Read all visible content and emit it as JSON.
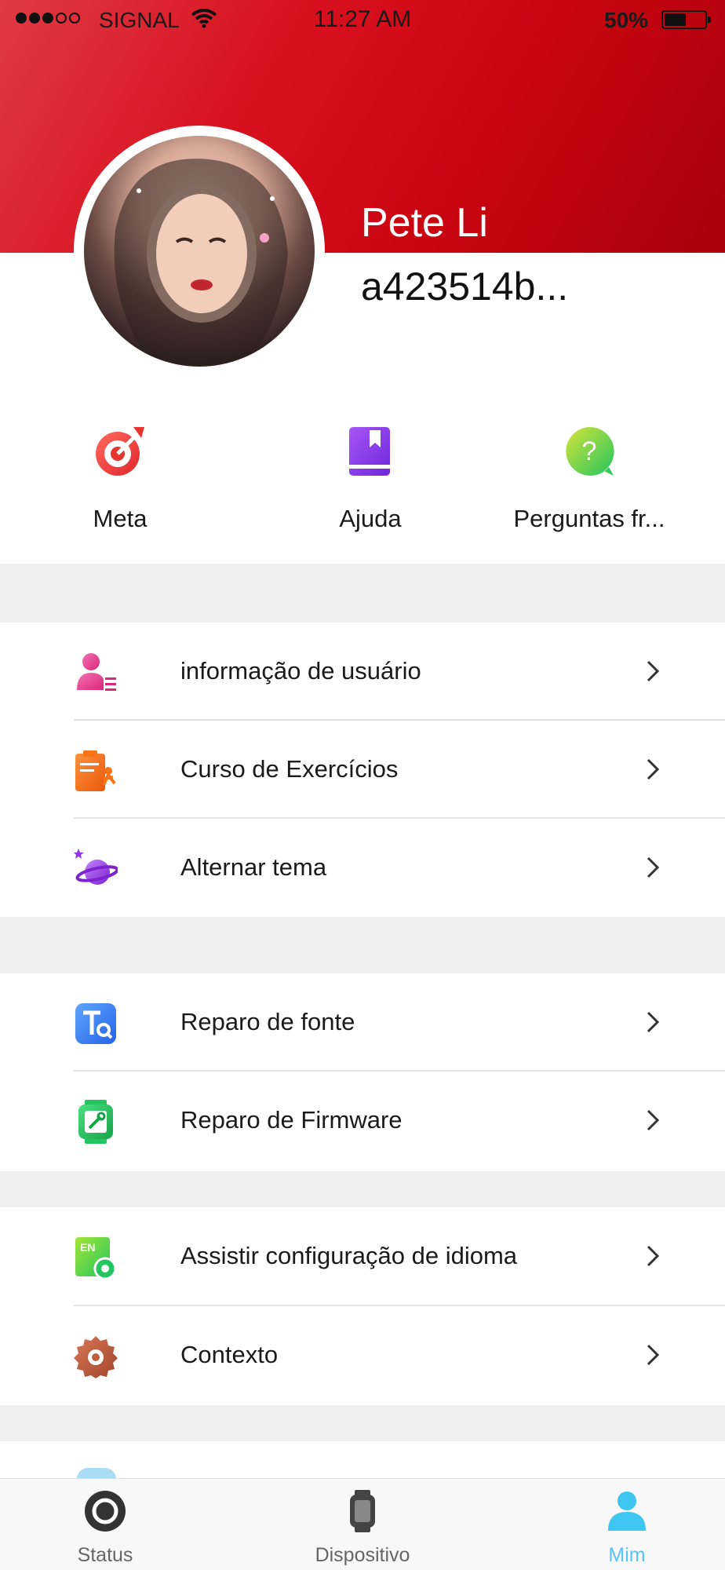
{
  "status_bar": {
    "carrier": "SIGNAL",
    "time": "11:27 AM",
    "battery": "50%"
  },
  "profile": {
    "name": "Pete Li",
    "id": "a423514b..."
  },
  "quick_actions": [
    {
      "label": "Meta",
      "icon": "target-icon"
    },
    {
      "label": "Ajuda",
      "icon": "book-icon"
    },
    {
      "label": "Perguntas fr...",
      "icon": "question-bubble-icon"
    }
  ],
  "menu_group_1": [
    {
      "label": "informação de usuário",
      "icon": "user-info-icon"
    },
    {
      "label": "Curso de Exercícios",
      "icon": "exercise-course-icon"
    },
    {
      "label": "Alternar tema",
      "icon": "planet-icon"
    }
  ],
  "menu_group_2": [
    {
      "label": "Reparo de fonte",
      "icon": "font-repair-icon"
    },
    {
      "label": "Reparo de Firmware",
      "icon": "watch-repair-icon"
    }
  ],
  "menu_group_3": [
    {
      "label": "Assistir configuração de idioma",
      "icon": "language-icon"
    },
    {
      "label": "Contexto",
      "icon": "gear-icon"
    }
  ],
  "tabbar": {
    "items": [
      {
        "label": "Status",
        "icon": "status-ring-icon"
      },
      {
        "label": "Dispositivo",
        "icon": "watch-icon"
      },
      {
        "label": "Mim",
        "icon": "person-icon",
        "active": true
      }
    ],
    "active_color": "#57c5f2"
  },
  "colors": {
    "header_red": "#d8111f"
  }
}
